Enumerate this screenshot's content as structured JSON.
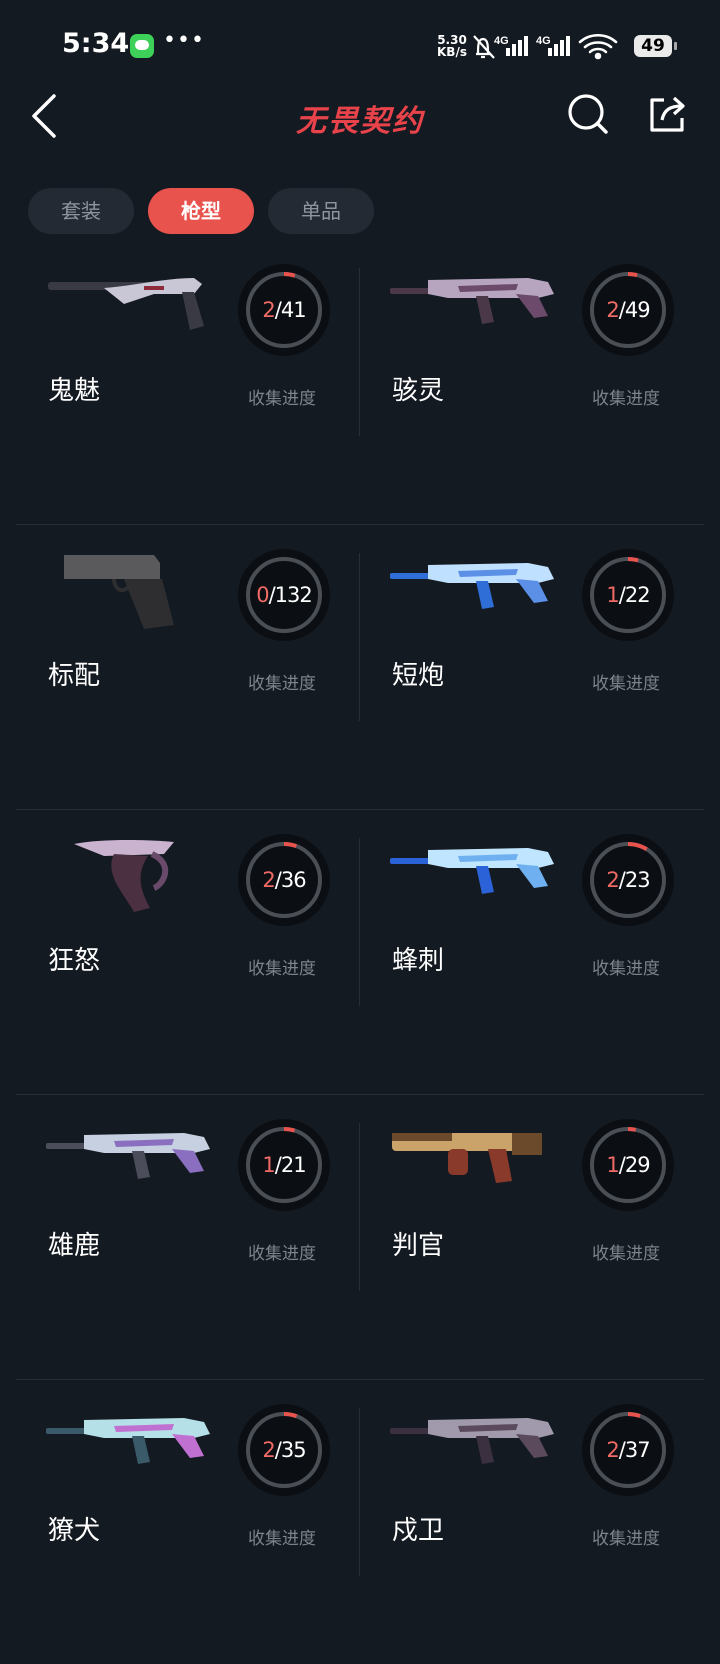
{
  "status_bar": {
    "time": "5:34",
    "net_speed_value": "5.30",
    "net_speed_unit": "KB/s",
    "network_labels": [
      "4G",
      "4G"
    ],
    "battery": "49",
    "icons": [
      "message-icon",
      "more-icon",
      "mute-bell-icon",
      "signal-icon",
      "signal-icon",
      "wifi-icon",
      "battery-icon"
    ]
  },
  "header": {
    "title": "无畏契约",
    "title_color": "#e8434a",
    "icons": [
      "back-icon",
      "search-icon",
      "share-icon"
    ]
  },
  "tabs": [
    {
      "label": "套装",
      "active": false
    },
    {
      "label": "枪型",
      "active": true
    },
    {
      "label": "单品",
      "active": false
    }
  ],
  "accent_color": "#e8534e",
  "progress_label": "收集进度",
  "weapons": [
    {
      "name": "鬼魅",
      "owned": "2",
      "total": "41",
      "icon": "classic-pistol-skin"
    },
    {
      "name": "骇灵",
      "owned": "2",
      "total": "49",
      "icon": "spectre-smg-skin"
    },
    {
      "name": "标配",
      "owned": "0",
      "total": "132",
      "icon": "standard-pistol"
    },
    {
      "name": "短炮",
      "owned": "1",
      "total": "22",
      "icon": "bucky-shotgun-skin"
    },
    {
      "name": "狂怒",
      "owned": "2",
      "total": "36",
      "icon": "frenzy-pistol-skin"
    },
    {
      "name": "蜂刺",
      "owned": "2",
      "total": "23",
      "icon": "stinger-smg-skin"
    },
    {
      "name": "雄鹿",
      "owned": "1",
      "total": "21",
      "icon": "marshal-rifle-skin"
    },
    {
      "name": "判官",
      "owned": "1",
      "total": "29",
      "icon": "judge-shotgun-skin"
    },
    {
      "name": "獠犬",
      "owned": "2",
      "total": "35",
      "icon": "bulldog-rifle-skin"
    },
    {
      "name": "戍卫",
      "owned": "2",
      "total": "37",
      "icon": "guardian-rifle-skin"
    }
  ]
}
